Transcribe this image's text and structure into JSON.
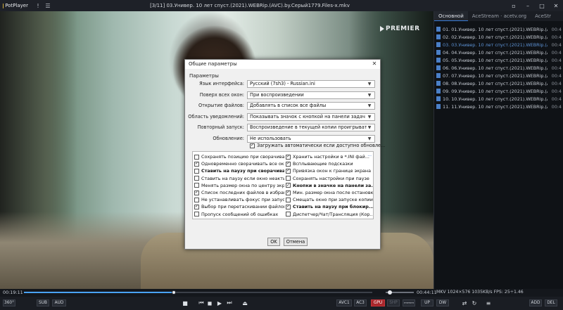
{
  "app": {
    "name": "PotPlayer",
    "title": "[3/11] 03.Универ. 10 лет спуст.(2021).WEBRip.(AVC).by.Серый1779.Files-x.mkv"
  },
  "video": {
    "watermark": "PREMIER"
  },
  "playlist": {
    "tabs": [
      "Основной",
      "AceStream · acetv.org",
      "AceStr"
    ],
    "items": [
      {
        "name": "01. 01.Универ. 10 лет спуст.(2021).WEBRip.(AVC).by.Серый1...",
        "duration": "00:4"
      },
      {
        "name": "02. 02.Универ. 10 лет спуст.(2021).WEBRip.(AVC).by.Серый1...",
        "duration": "00:4"
      },
      {
        "name": "03. 03.Универ. 10 лет спуст.(2021).WEBRip.(AVC).by.Серый1...",
        "duration": "00:4"
      },
      {
        "name": "04. 04.Универ. 10 лет спуст.(2021).WEBRip.(AVC).by.Серый1...",
        "duration": "00:4"
      },
      {
        "name": "05. 05.Универ. 10 лет спуст.(2021).WEBRip.(AVC).by.Серый1...",
        "duration": "00:4"
      },
      {
        "name": "06. 06.Универ. 10 лет спуст.(2021).WEBRip.(AVC).by.Серый1...",
        "duration": "00:4"
      },
      {
        "name": "07. 07.Универ. 10 лет спуст.(2021).WEBRip.(AVC).by.Серый1...",
        "duration": "00:4"
      },
      {
        "name": "08. 08.Универ. 10 лет спуст.(2021).WEBRip.(AVC).by.Серый1...",
        "duration": "00:4"
      },
      {
        "name": "09. 09.Универ. 10 лет спуст.(2021).WEBRip.(AVC).by.Серый1...",
        "duration": "00:4"
      },
      {
        "name": "10. 10.Универ. 10 лет спуст.(2021).WEBRip.(AVC).by.Серый1...",
        "duration": "00:4"
      },
      {
        "name": "11. 11.Универ. 10 лет спуст.(2021).WEBRip.(AVC).by.Серый1...",
        "duration": "00:4"
      }
    ],
    "current_index": 2
  },
  "dialog": {
    "title": "Общие параметры",
    "group_label": "Параметры",
    "rows": [
      {
        "label": "Язык интерфейса:",
        "value": "Русский (7sh3) - Russian.ini"
      },
      {
        "label": "Поверх всех окон:",
        "value": "При воспроизведении"
      },
      {
        "label": "Открытие файлов:",
        "value": "Добавлять в список все файлы"
      },
      {
        "label": "Область уведомлений:",
        "value": "Показывать значок с кнопкой на панели задач"
      },
      {
        "label": "Повторный запуск:",
        "value": "Воспроизведение в текущей копии проигрывателя"
      },
      {
        "label": "Обновление:",
        "value": "Не использовать"
      }
    ],
    "auto_update": {
      "label": "Загружать автоматически если доступно обновле...",
      "checked": true
    },
    "options_more": "...",
    "options_left": [
      {
        "label": "Сохранять позицию при сворачивании",
        "checked": false,
        "bold": false
      },
      {
        "label": "Одновременно сворачивать все окна",
        "checked": true,
        "bold": false
      },
      {
        "label": "Ставить на паузу при сворачивании",
        "checked": false,
        "bold": true
      },
      {
        "label": "Ставить на паузу если окно неактивно",
        "checked": false,
        "bold": false
      },
      {
        "label": "Менять размер окна по центру экрана",
        "checked": false,
        "bold": false
      },
      {
        "label": "Список последних файлов в избранн...",
        "checked": true,
        "bold": false
      },
      {
        "label": "Не устанавливать фокус при запуске",
        "checked": false,
        "bold": false
      },
      {
        "label": "Выбор при перетаскивании файлов",
        "checked": true,
        "bold": false
      },
      {
        "label": "Пропуск сообщений об ошибках",
        "checked": false,
        "bold": false
      }
    ],
    "options_right": [
      {
        "label": "Хранить настройки в *.INI фай...",
        "checked": true,
        "bold": false
      },
      {
        "label": "Всплывающие подсказки",
        "checked": true,
        "bold": false
      },
      {
        "label": "Привязка окон к границе экрана",
        "checked": true,
        "bold": false
      },
      {
        "label": "Сохранять настройки при паузе",
        "checked": false,
        "bold": false
      },
      {
        "label": "Кнопки в значке на панели за...",
        "checked": true,
        "bold": true
      },
      {
        "label": "Мин. размер окна после остановки",
        "checked": true,
        "bold": false
      },
      {
        "label": "Смещать окно при запуске копии",
        "checked": false,
        "bold": false
      },
      {
        "label": "Ставить на паузу при блокир...",
        "checked": true,
        "bold": true
      },
      {
        "label": "Диспетчер/Чат/Трансляция (Кор...",
        "checked": false,
        "bold": false
      }
    ],
    "ok_label": "OK",
    "cancel_label": "Отмена"
  },
  "status": {
    "time_current": "00:19:11",
    "time_total": "00:44:11",
    "progress_fraction": 0.43,
    "volume_fraction": 0.15,
    "info": "MKV  1024×576  1035KB/s  FPS: 25÷1.46"
  },
  "controls": {
    "left_buttons": [
      "360°",
      "SUB",
      "AUD"
    ],
    "right_buttons": [
      "AVC1",
      "AC3",
      "GPU",
      "SHP",
      "ꟷꟷꟷ",
      "UP",
      "DW",
      "ADD",
      "DEL"
    ]
  }
}
